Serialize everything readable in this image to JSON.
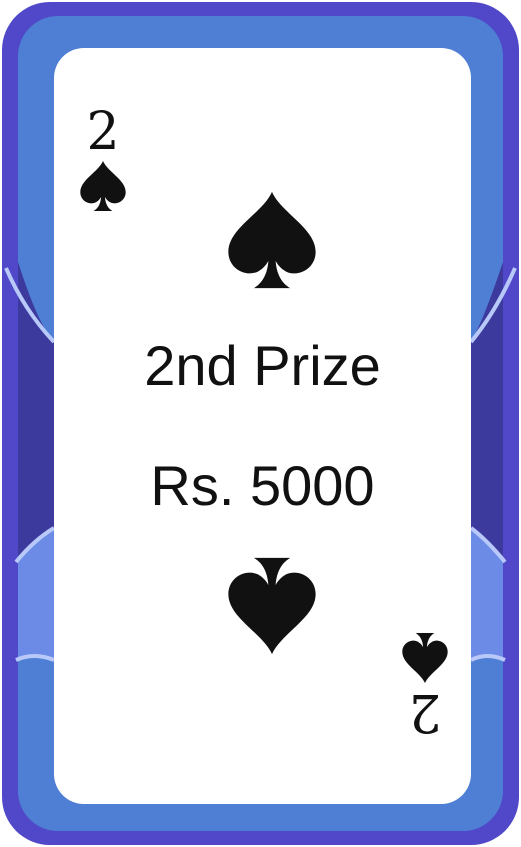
{
  "card": {
    "rank": "2",
    "suit_icon": "spade-icon",
    "prize_title": "2nd Prize",
    "prize_amount": "Rs. 5000"
  },
  "colors": {
    "frame_outer": "#5048C8",
    "frame_inner": "#4F7FD4",
    "frame_dark": "#3D3A9E",
    "frame_light": "#6C8BE6",
    "accent_line": "#B8C8F8",
    "card_face": "#FFFFFF",
    "ink": "#111111"
  }
}
